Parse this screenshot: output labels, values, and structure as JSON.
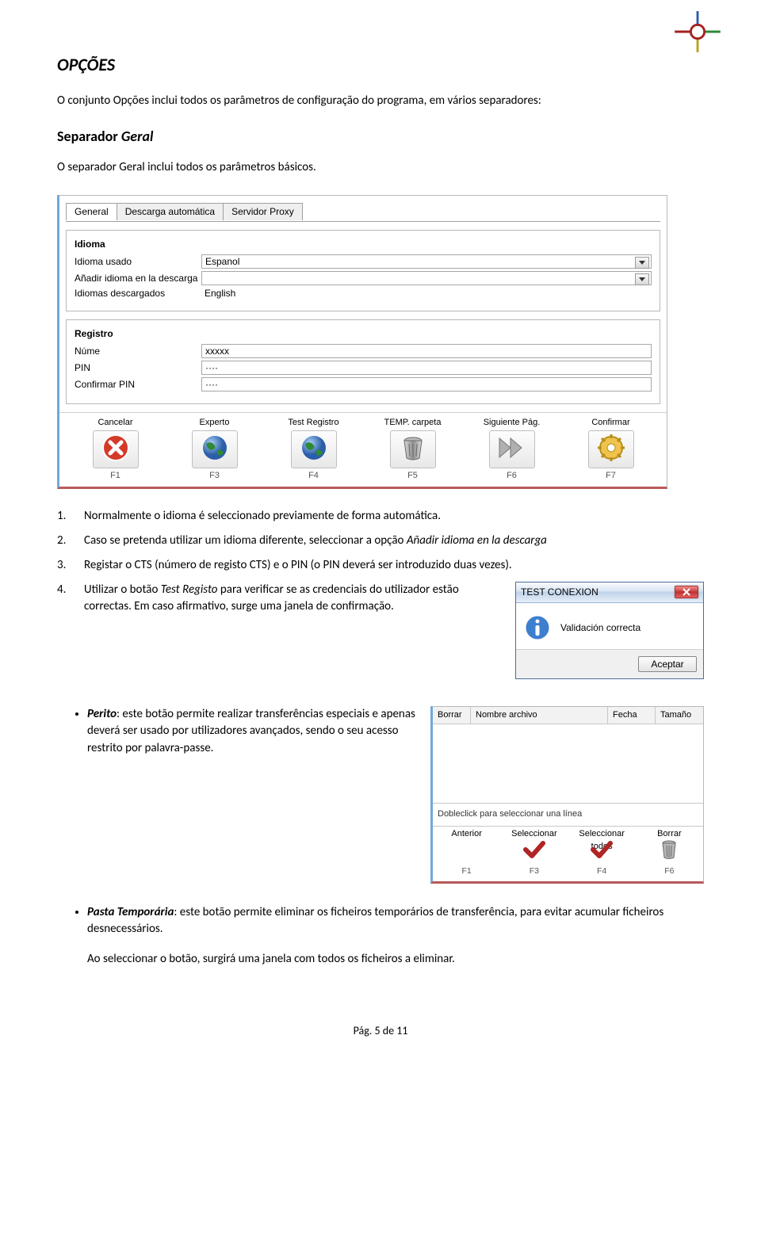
{
  "doc": {
    "heading1": "OPÇÕES",
    "intro": "O conjunto Opções inclui todos os parâmetros de configuração do programa, em vários separadores:",
    "heading2_prefix": "Separador ",
    "heading2_italic": "Geral",
    "line_separador": "O separador Geral inclui todos os parâmetros básicos.",
    "n1": "Normalmente o idioma é seleccionado previamente de forma automática.",
    "n2_a": "Caso se pretenda utilizar um idioma diferente, seleccionar a opção ",
    "n2_i": "Añadir idioma en la descarga",
    "n3": "Registar o CTS (número de registo CTS) e o PIN (o PIN deverá ser introduzido duas vezes).",
    "n4_a": "Utilizar o botão ",
    "n4_i": "Test Registo",
    "n4_b": " para verificar se as credenciais do utilizador estão correctas. Em caso afirmativo, surge uma janela de confirmação.",
    "bul1_b": "Perito",
    "bul1_t": ": este botão permite realizar transferências especiais e apenas deverá ser usado por utilizadores avançados, sendo o seu acesso restrito por palavra-passe.",
    "bul2_b": "Pasta Temporária",
    "bul2_t": ": este botão permite eliminar os ficheiros temporários de transferência, para evitar acumular ficheiros desnecessários.",
    "bul2_p2": "Ao seleccionar o botão, surgirá uma janela com todos os ficheiros a eliminar.",
    "footer": "Pág. 5 de 11"
  },
  "s1": {
    "tabs": [
      "General",
      "Descarga automática",
      "Servidor Proxy"
    ],
    "active_tab_index": 0,
    "g1": {
      "title": "Idioma",
      "rows": {
        "idioma_usado": {
          "label": "Idioma usado",
          "value": "Espanol"
        },
        "anadir": {
          "label": "Añadir idioma en la descarga",
          "value": ""
        },
        "descargados": {
          "label": "Idiomas descargados",
          "value": "English"
        }
      }
    },
    "g2": {
      "title": "Registro",
      "rows": {
        "nume": {
          "label": "Núme",
          "value": "xxxxx"
        },
        "pin": {
          "label": "PIN",
          "value": "····"
        },
        "confirm": {
          "label": "Confirmar PIN",
          "value": "····"
        }
      }
    },
    "buttons": [
      {
        "label": "Cancelar",
        "fkey": "F1",
        "icon": "cancel"
      },
      {
        "label": "Experto",
        "fkey": "F3",
        "icon": "globe"
      },
      {
        "label": "Test Registro",
        "fkey": "F4",
        "icon": "globe"
      },
      {
        "label": "TEMP. carpeta",
        "fkey": "F5",
        "icon": "trash"
      },
      {
        "label": "Siguiente Pág.",
        "fkey": "F6",
        "icon": "next"
      },
      {
        "label": "Confirmar",
        "fkey": "F7",
        "icon": "confirm"
      }
    ]
  },
  "s2": {
    "title": "TEST CONEXION",
    "message": "Validación correcta",
    "button": "Aceptar"
  },
  "s3": {
    "cols": [
      "Borrar",
      "Nombre archivo",
      "Fecha",
      "Tamaño"
    ],
    "tip": "Dobleclick para seleccionar una línea",
    "buttons": [
      {
        "label": "Anterior",
        "fkey": "F1",
        "icon": "none"
      },
      {
        "label": "Seleccionar",
        "fkey": "F3",
        "icon": "check"
      },
      {
        "label": "Seleccionar todos",
        "fkey": "F4",
        "icon": "check"
      },
      {
        "label": "Borrar",
        "fkey": "F6",
        "icon": "trash"
      }
    ]
  }
}
